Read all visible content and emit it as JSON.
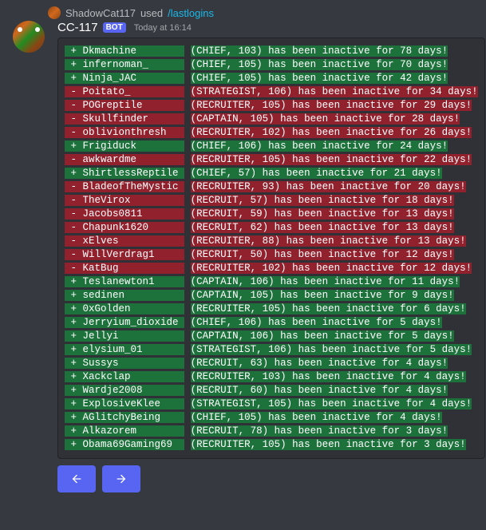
{
  "used_by": {
    "name": "ShadowCat117",
    "verb": "used",
    "command": "/lastlogins"
  },
  "header": {
    "bot_name": "CC-117",
    "bot_tag": "BOT",
    "timestamp": "Today at 16:14"
  },
  "rows": [
    {
      "sign": "+",
      "name": "Dkmachine",
      "rank": "CHIEF",
      "level": "103",
      "days": "78"
    },
    {
      "sign": "+",
      "name": "infernoman_",
      "rank": "CHIEF",
      "level": "105",
      "days": "70"
    },
    {
      "sign": "+",
      "name": "Ninja_JAC",
      "rank": "CHIEF",
      "level": "105",
      "days": "42"
    },
    {
      "sign": "-",
      "name": "Poitato_",
      "rank": "STRATEGIST",
      "level": "106",
      "days": "34"
    },
    {
      "sign": "-",
      "name": "POGreptile",
      "rank": "RECRUITER",
      "level": "105",
      "days": "29"
    },
    {
      "sign": "-",
      "name": "Skullfinder",
      "rank": "CAPTAIN",
      "level": "105",
      "days": "28"
    },
    {
      "sign": "-",
      "name": "oblivionthresh",
      "rank": "RECRUITER",
      "level": "102",
      "days": "26"
    },
    {
      "sign": "+",
      "name": "Frigiduck",
      "rank": "CHIEF",
      "level": "106",
      "days": "24"
    },
    {
      "sign": "-",
      "name": "awkwardme",
      "rank": "RECRUITER",
      "level": "105",
      "days": "22"
    },
    {
      "sign": "+",
      "name": "ShirtlessReptile",
      "rank": "CHIEF",
      "level": "57",
      "days": "21"
    },
    {
      "sign": "-",
      "name": "BladeofTheMystic",
      "rank": "RECRUITER",
      "level": "93",
      "days": "20"
    },
    {
      "sign": "-",
      "name": "TheVirox",
      "rank": "RECRUIT",
      "level": "57",
      "days": "18"
    },
    {
      "sign": "-",
      "name": "Jacobs0811",
      "rank": "RECRUIT",
      "level": "59",
      "days": "13"
    },
    {
      "sign": "-",
      "name": "Chapunk1620",
      "rank": "RECRUIT",
      "level": "62",
      "days": "13"
    },
    {
      "sign": "-",
      "name": "xElves",
      "rank": "RECRUITER",
      "level": "88",
      "days": "13"
    },
    {
      "sign": "-",
      "name": "WillVerdrag1",
      "rank": "RECRUIT",
      "level": "50",
      "days": "12"
    },
    {
      "sign": "-",
      "name": "KatBug",
      "rank": "RECRUITER",
      "level": "102",
      "days": "12"
    },
    {
      "sign": "+",
      "name": "Teslanewton1",
      "rank": "CAPTAIN",
      "level": "106",
      "days": "11"
    },
    {
      "sign": "+",
      "name": "sedinen",
      "rank": "CAPTAIN",
      "level": "105",
      "days": "9"
    },
    {
      "sign": "+",
      "name": "0xGolden",
      "rank": "RECRUITER",
      "level": "105",
      "days": "6"
    },
    {
      "sign": "+",
      "name": "Jerryium_dioxide",
      "rank": "CHIEF",
      "level": "106",
      "days": "5"
    },
    {
      "sign": "+",
      "name": "Jellyi",
      "rank": "CAPTAIN",
      "level": "106",
      "days": "5"
    },
    {
      "sign": "+",
      "name": "elysium_01",
      "rank": "STRATEGIST",
      "level": "106",
      "days": "5"
    },
    {
      "sign": "+",
      "name": "Sussys",
      "rank": "RECRUIT",
      "level": "63",
      "days": "4"
    },
    {
      "sign": "+",
      "name": "Xackclap",
      "rank": "RECRUITER",
      "level": "103",
      "days": "4"
    },
    {
      "sign": "+",
      "name": "Wardje2008",
      "rank": "RECRUIT",
      "level": "60",
      "days": "4"
    },
    {
      "sign": "+",
      "name": "ExplosiveKlee",
      "rank": "STRATEGIST",
      "level": "105",
      "days": "4"
    },
    {
      "sign": "+",
      "name": "AGlitchyBeing",
      "rank": "CHIEF",
      "level": "105",
      "days": "4"
    },
    {
      "sign": "+",
      "name": "Alkazorem",
      "rank": "RECRUIT",
      "level": "78",
      "days": "3"
    },
    {
      "sign": "+",
      "name": "Obama69Gaming69",
      "rank": "RECRUITER",
      "level": "105",
      "days": "3"
    }
  ],
  "name_col_width": 17
}
